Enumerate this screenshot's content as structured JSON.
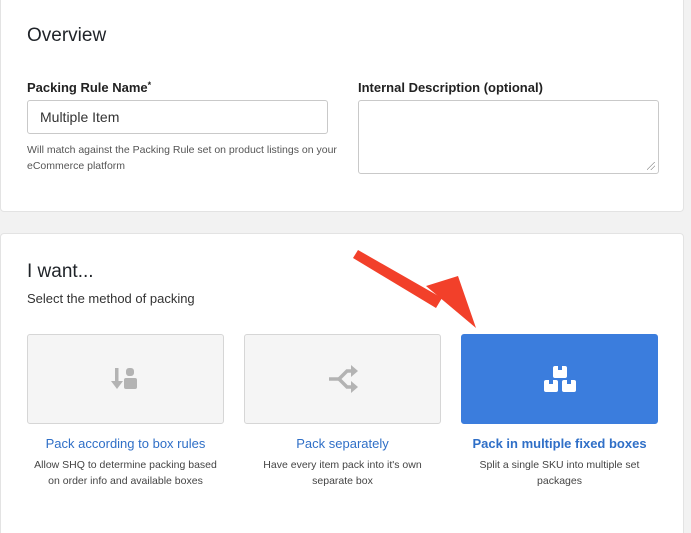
{
  "overview": {
    "title": "Overview",
    "packing_rule_name": {
      "label": "Packing Rule Name",
      "required_marker": "*",
      "value": "Multiple Item",
      "help": "Will match against the Packing Rule set on product listings on your eCommerce platform"
    },
    "internal_description": {
      "label": "Internal Description (optional)",
      "value": ""
    }
  },
  "method": {
    "title": "I want...",
    "subtitle": "Select the method of packing",
    "options": [
      {
        "title": "Pack according to box rules",
        "description": "Allow SHQ to determine packing based on order info and available boxes",
        "icon": "box-rules-icon",
        "selected": false
      },
      {
        "title": "Pack separately",
        "description": "Have every item pack into it's own separate box",
        "icon": "split-arrows-icon",
        "selected": false
      },
      {
        "title": "Pack in multiple fixed boxes",
        "description": "Split a single SKU into multiple set packages",
        "icon": "stacked-boxes-icon",
        "selected": true
      }
    ]
  },
  "colors": {
    "accent": "#3b7ddd",
    "link": "#2f6fc7",
    "annotation_arrow": "#f2402a"
  }
}
